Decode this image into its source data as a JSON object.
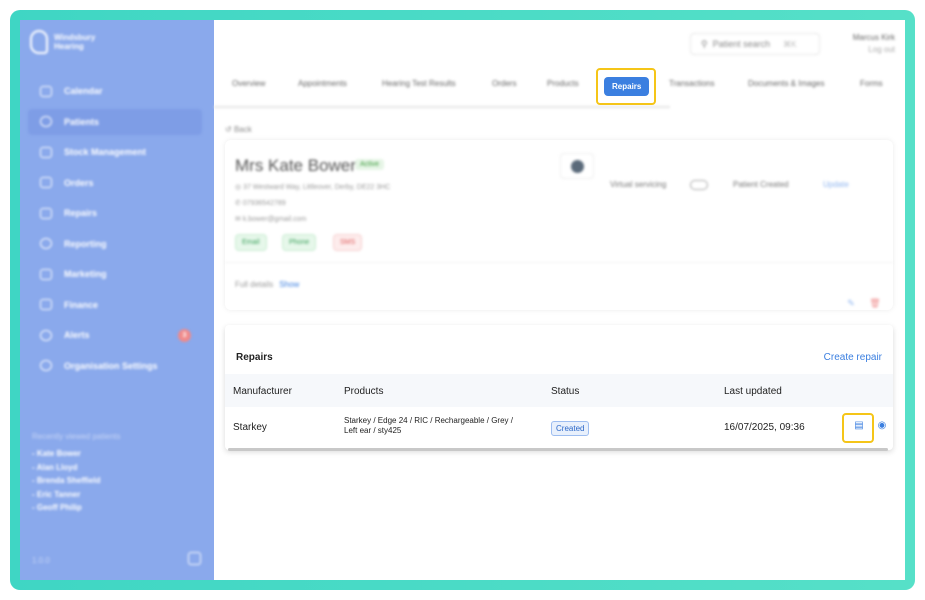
{
  "brand": {
    "name_line1": "Windsbury",
    "name_line2": "Hearing"
  },
  "colors": {
    "sidebar": "#8aa9ec",
    "accent": "#3b7fe0",
    "highlight": "#f5c518",
    "frame": "#3fd6c4"
  },
  "sidebar": {
    "items": [
      {
        "label": "Calendar",
        "icon": "calendar-icon"
      },
      {
        "label": "Patients",
        "icon": "patients-icon",
        "active": true
      },
      {
        "label": "Stock Management",
        "icon": "stock-icon"
      },
      {
        "label": "Orders",
        "icon": "orders-icon"
      },
      {
        "label": "Repairs",
        "icon": "wrench-icon"
      },
      {
        "label": "Reporting",
        "icon": "chart-icon"
      },
      {
        "label": "Marketing",
        "icon": "mail-icon"
      },
      {
        "label": "Finance",
        "icon": "finance-icon"
      },
      {
        "label": "Alerts",
        "icon": "bell-icon",
        "badge": "3"
      },
      {
        "label": "Organisation Settings",
        "icon": "gear-icon"
      }
    ],
    "recent_title": "Recently viewed patients",
    "recent": [
      "- Kate Bower",
      "- Alan Lloyd",
      "- Brenda Sheffield",
      "- Eric Tanner",
      "- Geoff Philip"
    ],
    "version": "1.0.0"
  },
  "header": {
    "search_placeholder": "Patient search",
    "search_shortcut": "⌘K",
    "user_name": "Marcus Kirk",
    "logout": "Log out"
  },
  "tabs": [
    "Overview",
    "Appointments",
    "Hearing Test Results",
    "Orders",
    "Products",
    "Repairs",
    "Transactions",
    "Documents & Images",
    "Forms"
  ],
  "active_tab": "Repairs",
  "patient": {
    "back": "Back",
    "name": "Mrs Kate Bower",
    "status": "Active",
    "address": "37 Westward Way, Littleover, Derby, DE22 3HC",
    "phone": "07936542789",
    "email": "k.bower@gmail.com",
    "channels": [
      "Email",
      "Phone",
      "SMS"
    ],
    "virtual_servicing": "Virtual servicing",
    "patient_created": "Patient Created",
    "update": "Update",
    "full_details": "Full details",
    "show": "Show"
  },
  "repairs": {
    "title": "Repairs",
    "create": "Create repair",
    "columns": [
      "Manufacturer",
      "Products",
      "Status",
      "Last updated"
    ],
    "rows": [
      {
        "manufacturer": "Starkey",
        "products_line1": "Starkey / Edge 24 / RIC / Rechargeable / Grey /",
        "products_line2": "Left ear / sty425",
        "status": "Created",
        "last_updated": "16/07/2025, 09:36"
      }
    ]
  }
}
